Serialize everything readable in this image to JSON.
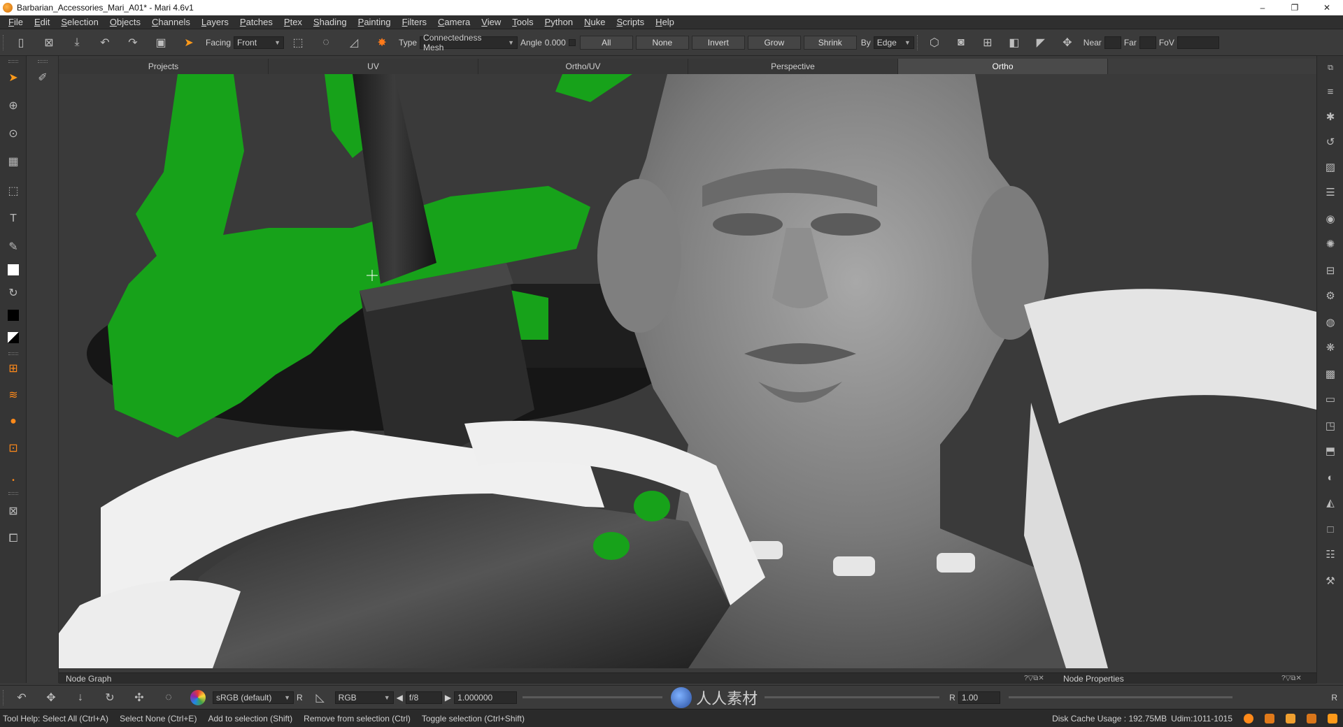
{
  "window": {
    "title": "Barbarian_Accessories_Mari_A01* - Mari 4.6v1",
    "minimize": "–",
    "maximize": "❐",
    "close": "✕"
  },
  "menu": [
    "File",
    "Edit",
    "Selection",
    "Objects",
    "Channels",
    "Layers",
    "Patches",
    "Ptex",
    "Shading",
    "Painting",
    "Filters",
    "Camera",
    "View",
    "Tools",
    "Python",
    "Nuke",
    "Scripts",
    "Help"
  ],
  "toolbar": {
    "facing_label": "Facing",
    "facing_value": "Front",
    "type_label": "Type",
    "type_value": "Connectedness Mesh",
    "angle_label": "Angle",
    "angle_value": "0.000",
    "all_label": "All",
    "none_label": "None",
    "invert_label": "Invert",
    "grow_label": "Grow",
    "shrink_label": "Shrink",
    "by_label": "By",
    "by_value": "Edge",
    "near_label": "Near",
    "far_label": "Far",
    "fov_label": "FoV"
  },
  "viewport_tabs": [
    "Projects",
    "UV",
    "Ortho/UV",
    "Perspective",
    "Ortho"
  ],
  "active_tab": "Ortho",
  "panels": {
    "node_graph": "Node Graph",
    "node_properties": "Node Properties"
  },
  "bottom": {
    "colorspace": "sRGB (default)",
    "colorspace_flag": "R",
    "channel": "RGB",
    "fstop": "f/8",
    "exposure": "1.000000",
    "gain_label": "R",
    "gain_value": "1.00",
    "right_flag": "R",
    "watermark": "人人素材"
  },
  "status": {
    "help_items": [
      "Tool Help: Select All (Ctrl+A)",
      "Select None (Ctrl+E)",
      "Add to selection (Shift)",
      "Remove from selection (Ctrl)",
      "Toggle selection (Ctrl+Shift)"
    ],
    "disk_cache": "Disk Cache Usage : 192.75MB",
    "udim": "Udim:1011-1015"
  },
  "colors": {
    "selection_green": "#17a21a",
    "background": "#3a3a3a"
  },
  "icons": {
    "select": "arrow-select-icon",
    "paint": "brush-icon",
    "text": "text-tool-icon"
  }
}
